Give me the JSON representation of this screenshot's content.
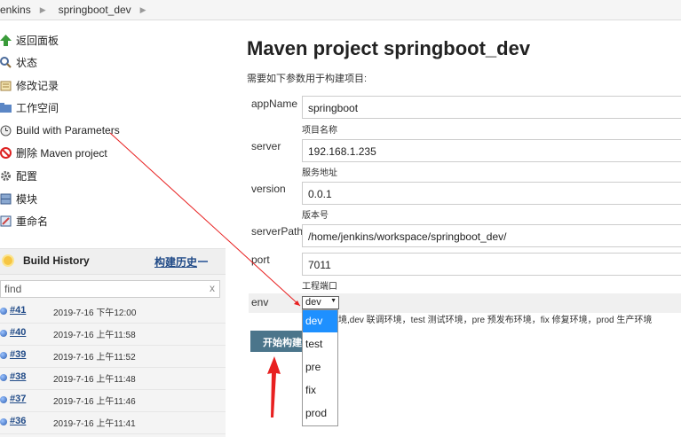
{
  "breadcrumb": [
    "Jenkins",
    "springboot_dev"
  ],
  "sidebar": {
    "tasks": [
      {
        "label": "返回面板",
        "icon": "up-arrow-icon"
      },
      {
        "label": "状态",
        "icon": "magnifier-icon"
      },
      {
        "label": "修改记录",
        "icon": "notepad-icon"
      },
      {
        "label": "工作空间",
        "icon": "folder-icon"
      },
      {
        "label": "Build with Parameters",
        "icon": "clock-icon"
      },
      {
        "label": "删除 Maven project",
        "icon": "no-entry-icon"
      },
      {
        "label": "配置",
        "icon": "gear-icon"
      },
      {
        "label": "模块",
        "icon": "module-icon"
      },
      {
        "label": "重命名",
        "icon": "rename-icon"
      }
    ]
  },
  "history": {
    "title": "Build History",
    "trend_link": "构建历史",
    "find_placeholder": "find",
    "clear": "x",
    "builds": [
      {
        "num": "#41",
        "date": "2019-7-16 下午12:00"
      },
      {
        "num": "#40",
        "date": "2019-7-16 上午11:58"
      },
      {
        "num": "#39",
        "date": "2019-7-16 上午11:52"
      },
      {
        "num": "#38",
        "date": "2019-7-16 上午11:48"
      },
      {
        "num": "#37",
        "date": "2019-7-16 上午11:46"
      },
      {
        "num": "#36",
        "date": "2019-7-16 上午11:41"
      }
    ]
  },
  "main": {
    "title": "Maven project springboot_dev",
    "intro": "需要如下参数用于构建项目:",
    "params": [
      {
        "name": "appName",
        "value": "springboot",
        "desc": "项目名称"
      },
      {
        "name": "server",
        "value": "192.168.1.235",
        "desc": "服务地址"
      },
      {
        "name": "version",
        "value": "0.0.1",
        "desc": "版本号"
      },
      {
        "name": "serverPath",
        "value": "/home/jenkins/workspace/springboot_dev/",
        "desc": ""
      },
      {
        "name": "port",
        "value": "7011",
        "desc": "工程端口"
      }
    ],
    "env": {
      "name": "env",
      "selected": "dev",
      "desc": "境,dev 联调环境，test 测试环境，pre 预发布环境，fix 修复环境，prod 生产环境",
      "options": [
        "dev",
        "test",
        "pre",
        "fix",
        "prod"
      ]
    },
    "build_button": "开始构建"
  },
  "colors": {
    "build_button": "#4b758b",
    "link": "#204a87",
    "annotation": "#e82020",
    "selected_option": "#1e90ff"
  }
}
